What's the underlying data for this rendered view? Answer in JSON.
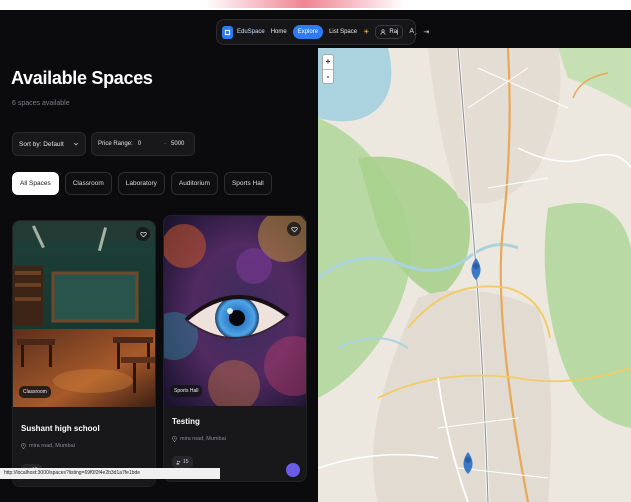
{
  "navbar": {
    "brand": "EduSpace",
    "links": [
      "Home",
      "Explore",
      "List Space"
    ],
    "active_link": "Explore",
    "user_name": "Raj",
    "icons": [
      "theme-sun-icon",
      "user-icon",
      "language-icon",
      "logout-icon"
    ]
  },
  "page": {
    "title": "Available Spaces",
    "count_text": "6 spaces available"
  },
  "filters": {
    "sort_value": "Sort by: Default",
    "price_label": "Price Range:",
    "price_min": "0",
    "price_max": "5000",
    "categories": [
      "All Spaces",
      "Classroom",
      "Laboratory",
      "Auditorium",
      "Sports Hall"
    ],
    "active_category": "All Spaces"
  },
  "listings": [
    {
      "tag": "Classroom",
      "title": "Sushant high school",
      "location": "mira road, Mumbai",
      "capacity": "10"
    },
    {
      "tag": "Sports Hall",
      "title": "Testing",
      "location": "mira road, Mumbai",
      "capacity": "15"
    }
  ],
  "map": {
    "zoom_in_label": "+",
    "zoom_out_label": "-"
  },
  "colors": {
    "accent": "#2d7cf6",
    "background": "#0b0b0d",
    "card": "#18181b"
  },
  "status_bar": {
    "url": "http://localhost:3000/spaces?listing=69f0f2f4e2b3d1a7fe1bde"
  }
}
